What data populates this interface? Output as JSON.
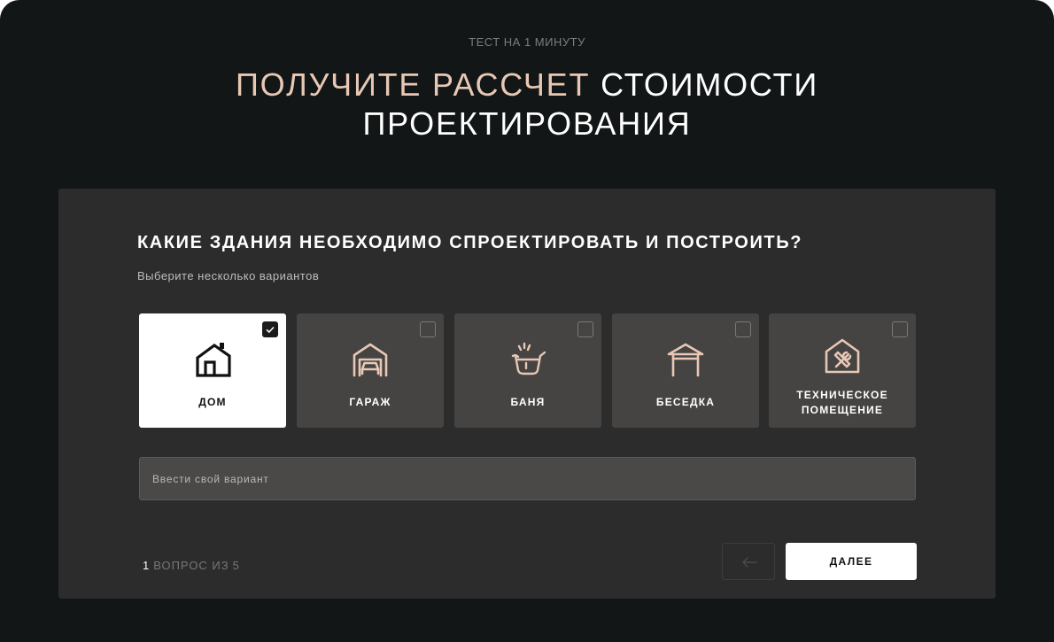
{
  "header": {
    "eyebrow": "ТЕСТ НА 1 МИНУТУ",
    "title_accent": "ПОЛУЧИТЕ РАССЧЕТ",
    "title_rest": "СТОИМОСТИ",
    "title_line2": "ПРОЕКТИРОВАНИЯ"
  },
  "quiz": {
    "question": "КАКИЕ ЗДАНИЯ НЕОБХОДИМО СПРОЕКТИРОВАТЬ И ПОСТРОИТЬ?",
    "hint": "Выберите несколько вариантов",
    "options": [
      {
        "label": "ДОМ",
        "icon": "house-icon",
        "selected": true
      },
      {
        "label": "ГАРАЖ",
        "icon": "garage-icon",
        "selected": false
      },
      {
        "label": "БАНЯ",
        "icon": "bathhouse-icon",
        "selected": false
      },
      {
        "label": "БЕСЕДКА",
        "icon": "gazebo-icon",
        "selected": false
      },
      {
        "label_line1": "ТЕХНИЧЕСКОЕ",
        "label_line2": "ПОМЕЩЕНИЕ",
        "icon": "utility-room-icon",
        "selected": false
      }
    ],
    "custom_placeholder": "Ввести свой вариант",
    "custom_value": ""
  },
  "footer": {
    "current": "1",
    "of_label": "ВОПРОС ИЗ",
    "total": "5",
    "back_icon": "arrow-left-icon",
    "next_label": "ДАЛЕЕ"
  },
  "colors": {
    "background": "#121616",
    "card": "#2c2c2c",
    "tile": "#454443",
    "tile_selected": "#ffffff",
    "accent": "#e8c8b5"
  }
}
